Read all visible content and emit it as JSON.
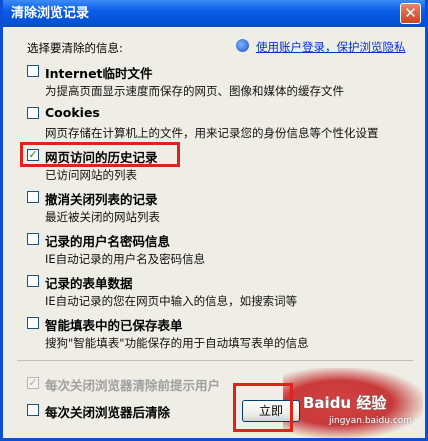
{
  "window": {
    "title": "清除浏览记录",
    "close_glyph": "✕"
  },
  "hint": "选择要清除的信息:",
  "help_link": "使用账户登录，保护浏览隐私",
  "options": [
    {
      "label": "Internet临时文件",
      "desc": "为提高页面显示速度而保存的网页、图像和媒体的缓存文件",
      "checked": false
    },
    {
      "label": "Cookies",
      "desc": "网页存储在计算机上的文件，用来记录您的身份信息等个性化设置",
      "checked": false
    },
    {
      "label": "网页访问的历史记录",
      "desc": "已访问网站的列表",
      "checked": true
    },
    {
      "label": "撤消关闭列表的记录",
      "desc": "最近被关闭的网站列表",
      "checked": false
    },
    {
      "label": "记录的用户名密码信息",
      "desc": "IE自动记录的用户名及密码信息",
      "checked": false
    },
    {
      "label": "记录的表单数据",
      "desc": "IE自动记录的您在网页中输入的信息，如搜索词等",
      "checked": false
    },
    {
      "label": "智能填表中的已保存表单",
      "desc": "搜狗\"智能填表\"功能保存的用于自动填写表单的信息",
      "checked": false
    }
  ],
  "footer": {
    "auto_user": {
      "label": "每次关闭浏览器清除前提示用户",
      "checked": true,
      "disabled": true
    },
    "auto_clear": {
      "label": "每次关闭浏览器后清除",
      "checked": false
    },
    "clear_button": "立即"
  },
  "watermark": {
    "text": "Baidu 经验",
    "url": "jingyan.baidu.com"
  },
  "colors": {
    "title_bar": "#0a5ce6",
    "highlight": "#e0231a",
    "link": "#0033cc"
  }
}
